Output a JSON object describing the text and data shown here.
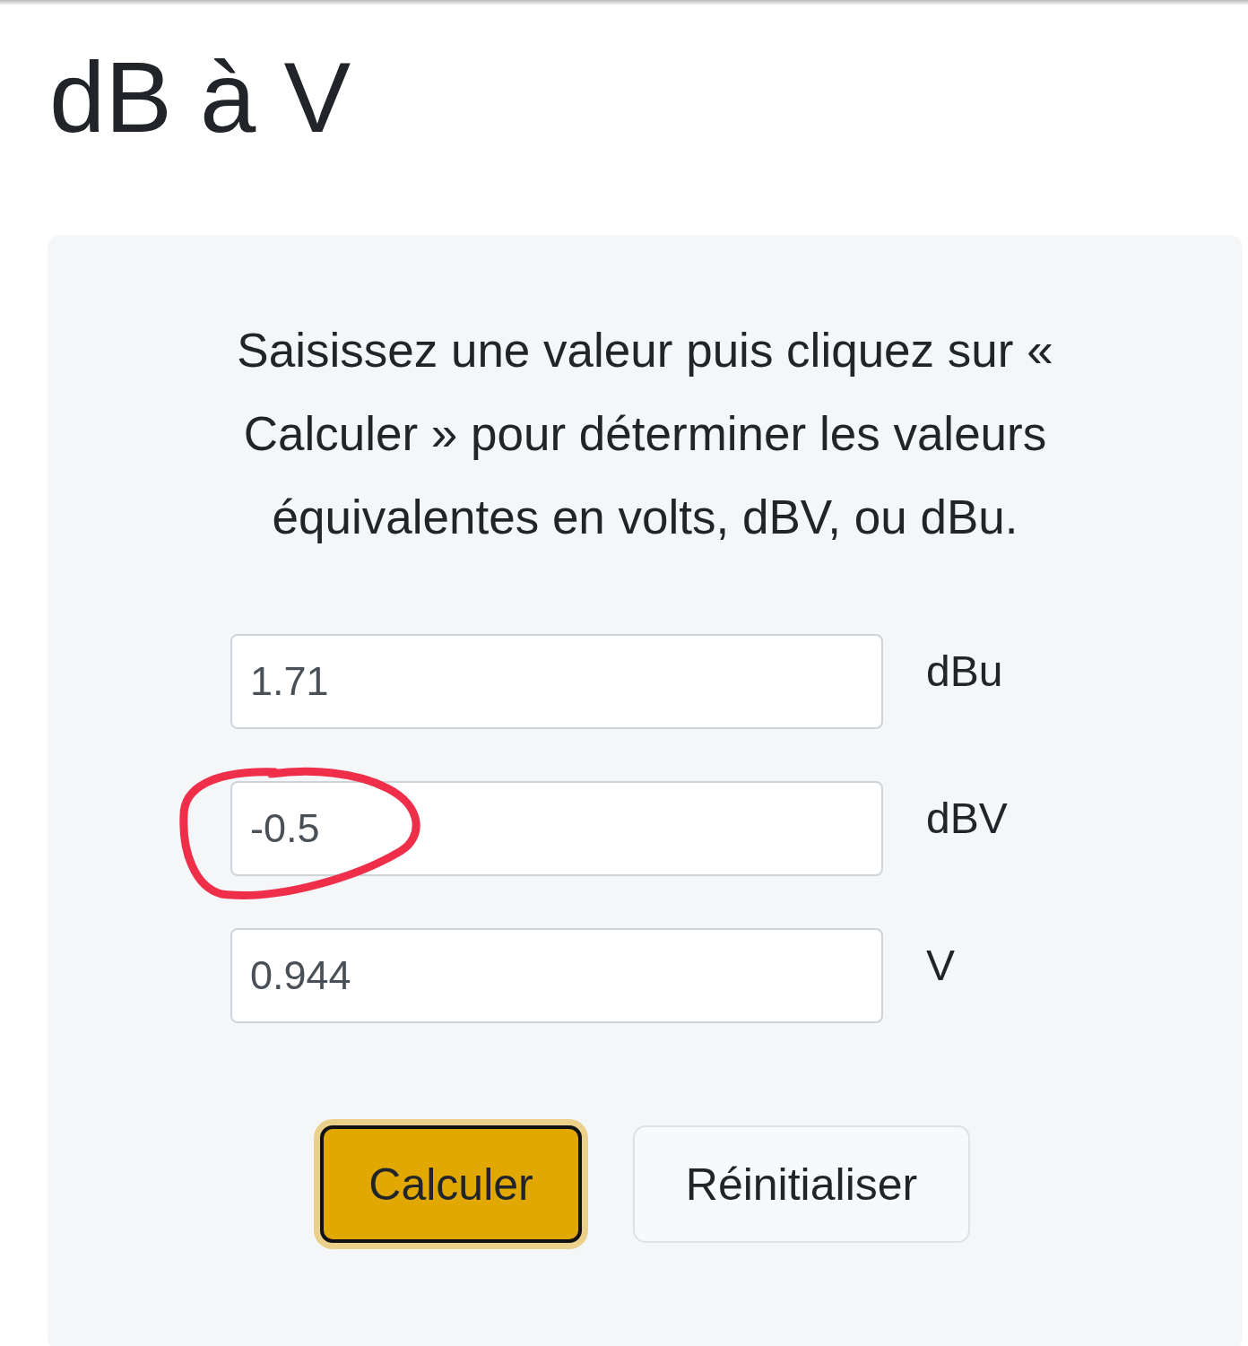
{
  "title": "dB à V",
  "instructions": "Saisissez une valeur puis cliquez sur « Calculer » pour déterminer les valeurs équivalentes en volts, dBV, ou dBu.",
  "fields": [
    {
      "value": "1.71",
      "unit": "dBu",
      "circled": false
    },
    {
      "value": "-0.5",
      "unit": "dBV",
      "circled": true
    },
    {
      "value": "0.944",
      "unit": "V",
      "circled": false
    }
  ],
  "buttons": [
    {
      "label": "Calculer",
      "kind": "primary",
      "focused": true
    },
    {
      "label": "Réinitialiser",
      "kind": "secondary",
      "focused": false
    }
  ]
}
